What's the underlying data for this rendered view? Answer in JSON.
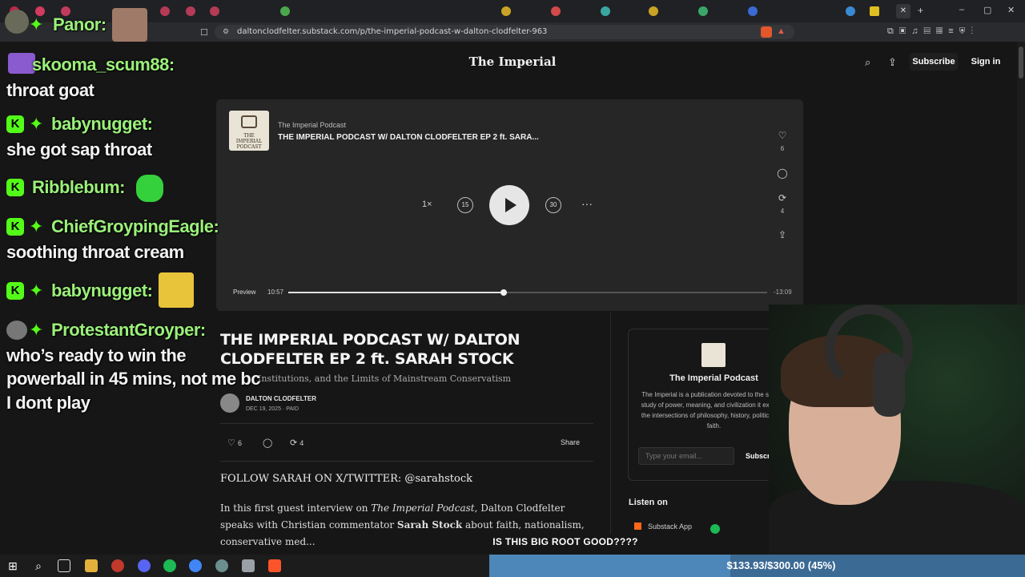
{
  "browser": {
    "url": "daltonclodfelter.substack.com/p/the-imperial-podcast-w-dalton-clodfelter-963",
    "window_controls": [
      "–",
      "▢",
      "✕"
    ]
  },
  "site": {
    "title": "The Imperial",
    "subscribe_label": "Subscribe",
    "signin_label": "Sign in"
  },
  "player": {
    "podcast_name": "The Imperial Podcast",
    "episode_title": "THE IMPERIAL PODCAST W/ DALTON CLODFELTER EP 2 ft. SARA...",
    "cover_text": "THE IMPERIAL PODCAST",
    "speed": "1×",
    "skip_back": "15",
    "skip_fwd": "30",
    "more": "···",
    "likes": "6",
    "restacks": "4",
    "preview_label": "Preview",
    "time_current": "10:57",
    "time_remaining": "-13:09",
    "progress": 0.45
  },
  "article": {
    "title": "THE IMPERIAL PODCAST W/ DALTON CLODFELTER EP 2 ft. SARAH STOCK",
    "subtitle": "Institutions, and the Limits of Mainstream Conservatism",
    "author": "DALTON CLODFELTER",
    "date": "DEC 19, 2025 · PAID",
    "likes": "6",
    "restacks": "4",
    "share_label": "Share",
    "follow_line": "FOLLOW SARAH ON X/TWITTER: @sarahstock",
    "body_1": "In this first guest interview on ",
    "body_italic": "The Imperial Podcast",
    "body_2": ", Dalton Clodfelter speaks with Christian commentator ",
    "body_bold": "Sarah Stock",
    "body_3": " about faith, nationalism, conservative med..."
  },
  "sidebar_card": {
    "title": "The Imperial Podcast",
    "description": "The Imperial is a publication devoted to the serious study of power, meaning, and civilization it explores the intersections of philosophy, history, politics, and faith.",
    "email_placeholder": "Type your email...",
    "subscribe_label": "Subscri",
    "listen_on": "Listen on",
    "substack_app": "Substack App"
  },
  "chat": [
    {
      "user": "Panor:",
      "msg": ""
    },
    {
      "user": "skooma_scum88:",
      "msg": "throat goat"
    },
    {
      "user": "babynugget:",
      "msg": "she got sap throat"
    },
    {
      "user": "Ribblebum:",
      "msg": ""
    },
    {
      "user": "ChiefGroypingEagle:",
      "msg": "soothing throat cream"
    },
    {
      "user": "babynugget:",
      "msg": ""
    },
    {
      "user": "ProtestantGroyper:",
      "msg": "who’s ready to win the"
    },
    {
      "user": "",
      "msg": "powerball in 45 mins, not me bc"
    },
    {
      "user": "",
      "msg": "I dont play"
    }
  ],
  "chat_badge": "K",
  "stream": {
    "caption": "IS THIS BIG ROOT GOOD????",
    "goal": "$133.93/$300.00 (45%)",
    "goal_fraction": 0.45
  },
  "colors": {
    "chat_user": "#9bf07a",
    "kick_green": "#53fc18",
    "goal_bar": "#3b6a94"
  }
}
